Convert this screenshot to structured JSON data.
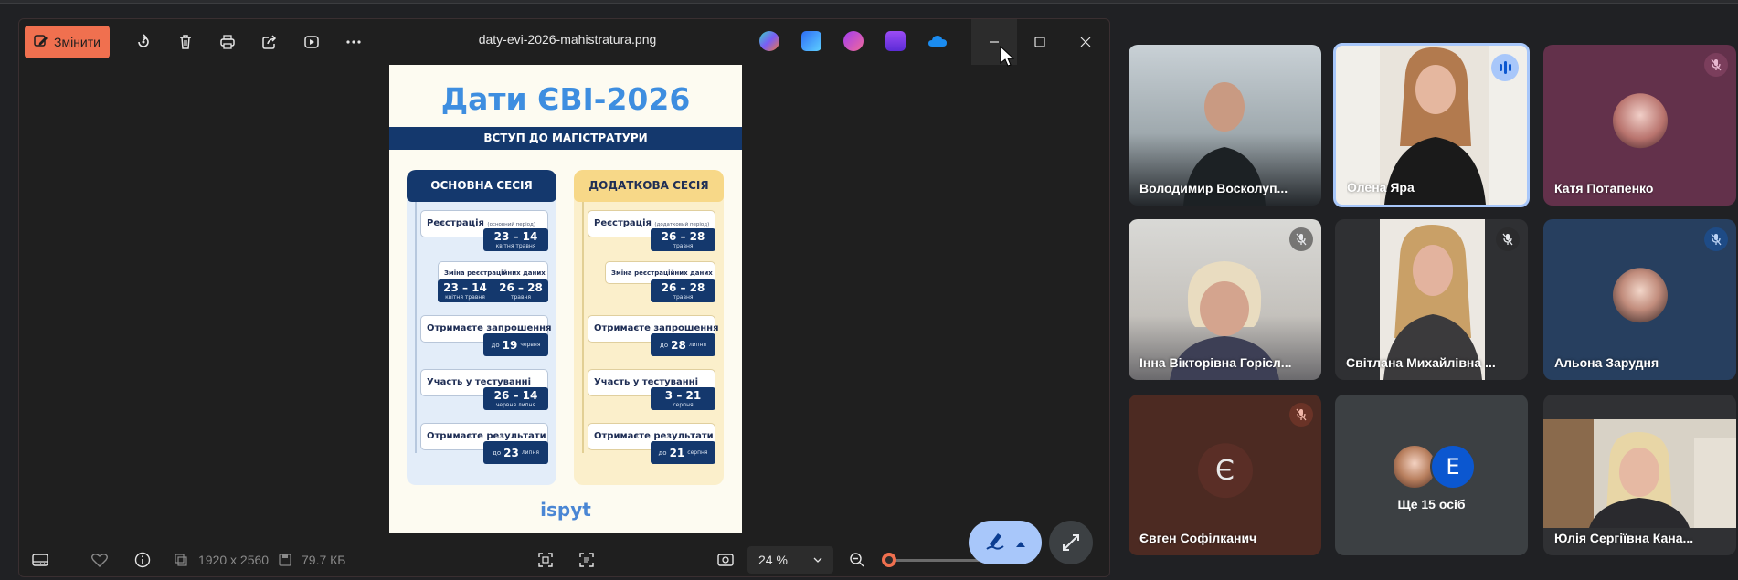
{
  "viewer": {
    "edit_label": "Змінити",
    "filename": "daty-evi-2026-mahistratura.png",
    "window_controls": [
      "minimize-icon",
      "maximize-icon",
      "close-icon"
    ],
    "toolbar_icons": [
      "rotate-icon",
      "delete-icon",
      "print-icon",
      "share-icon",
      "slideshow-icon",
      "more-icon"
    ],
    "app_icons": [
      "copilot-icon",
      "designer-icon",
      "clipchamp-icon",
      "stack-icon",
      "onedrive-icon"
    ],
    "accent_color": "#f0704f",
    "bottom": {
      "dimensions": "1920 x 2560",
      "file_size": "79.7 КБ",
      "zoom": "24 %"
    }
  },
  "image": {
    "title": "Дати ЄВІ-2026",
    "banner": "ВСТУП ДО МАГІСТРАТУРИ",
    "main_session": {
      "heading": "ОСНОВНА СЕСІЯ",
      "reg_label": "Реєстрація",
      "reg_note": "(основний період)",
      "reg_date": "23 – 14",
      "reg_sub": "квітня   травня",
      "change_label": "Зміна реєстраційних даних",
      "change_date_a": "23 – 14",
      "change_sub_a": "квітня   травня",
      "change_date_b": "26 – 28",
      "change_sub_b": "травня",
      "invite_label": "Отримаєте запрошення",
      "invite_pre": "до",
      "invite_num": "19",
      "invite_post": "червня",
      "test_label": "Участь у тестуванні",
      "test_date": "26 – 14",
      "test_sub": "червня   липня",
      "result_label": "Отримаєте результати",
      "result_pre": "до",
      "result_num": "23",
      "result_post": "липня"
    },
    "extra_session": {
      "heading": "ДОДАТКОВА СЕСІЯ",
      "reg_label": "Реєстрація",
      "reg_note": "(додатковий період)",
      "reg_date": "26 – 28",
      "reg_sub": "травня",
      "change_label": "Зміна реєстраційних даних",
      "change_date": "26 – 28",
      "change_sub": "травня",
      "invite_label": "Отримаєте запрошення",
      "invite_pre": "до",
      "invite_num": "28",
      "invite_post": "липня",
      "test_label": "Участь у тестуванні",
      "test_date": "3 – 21",
      "test_sub": "серпня",
      "result_label": "Отримаєте результати",
      "result_pre": "до",
      "result_num": "21",
      "result_post": "серпня"
    },
    "logo_main": "ispyt"
  },
  "participants": [
    {
      "name": "Володимир Восколуп...",
      "muted": false
    },
    {
      "name": "Олена Яра",
      "speaking": true
    },
    {
      "name": "Катя Потапенко",
      "muted": true
    },
    {
      "name": "Інна Вікторівна Горісл...",
      "muted": true
    },
    {
      "name": "Світлана Михайлівна ...",
      "muted": true
    },
    {
      "name": "Альона Зарудня",
      "muted": true
    },
    {
      "name": "Євген Софілканич",
      "muted": true,
      "initial": "Є"
    },
    {
      "name": "Ще 15 осіб",
      "initial": "E"
    },
    {
      "name": "Юлія Сергіївна Кана...",
      "muted": false
    }
  ],
  "colors": {
    "meet_blue": "#a8c7fa",
    "poster_navy": "#14386d",
    "poster_title": "#3e8ee0"
  }
}
